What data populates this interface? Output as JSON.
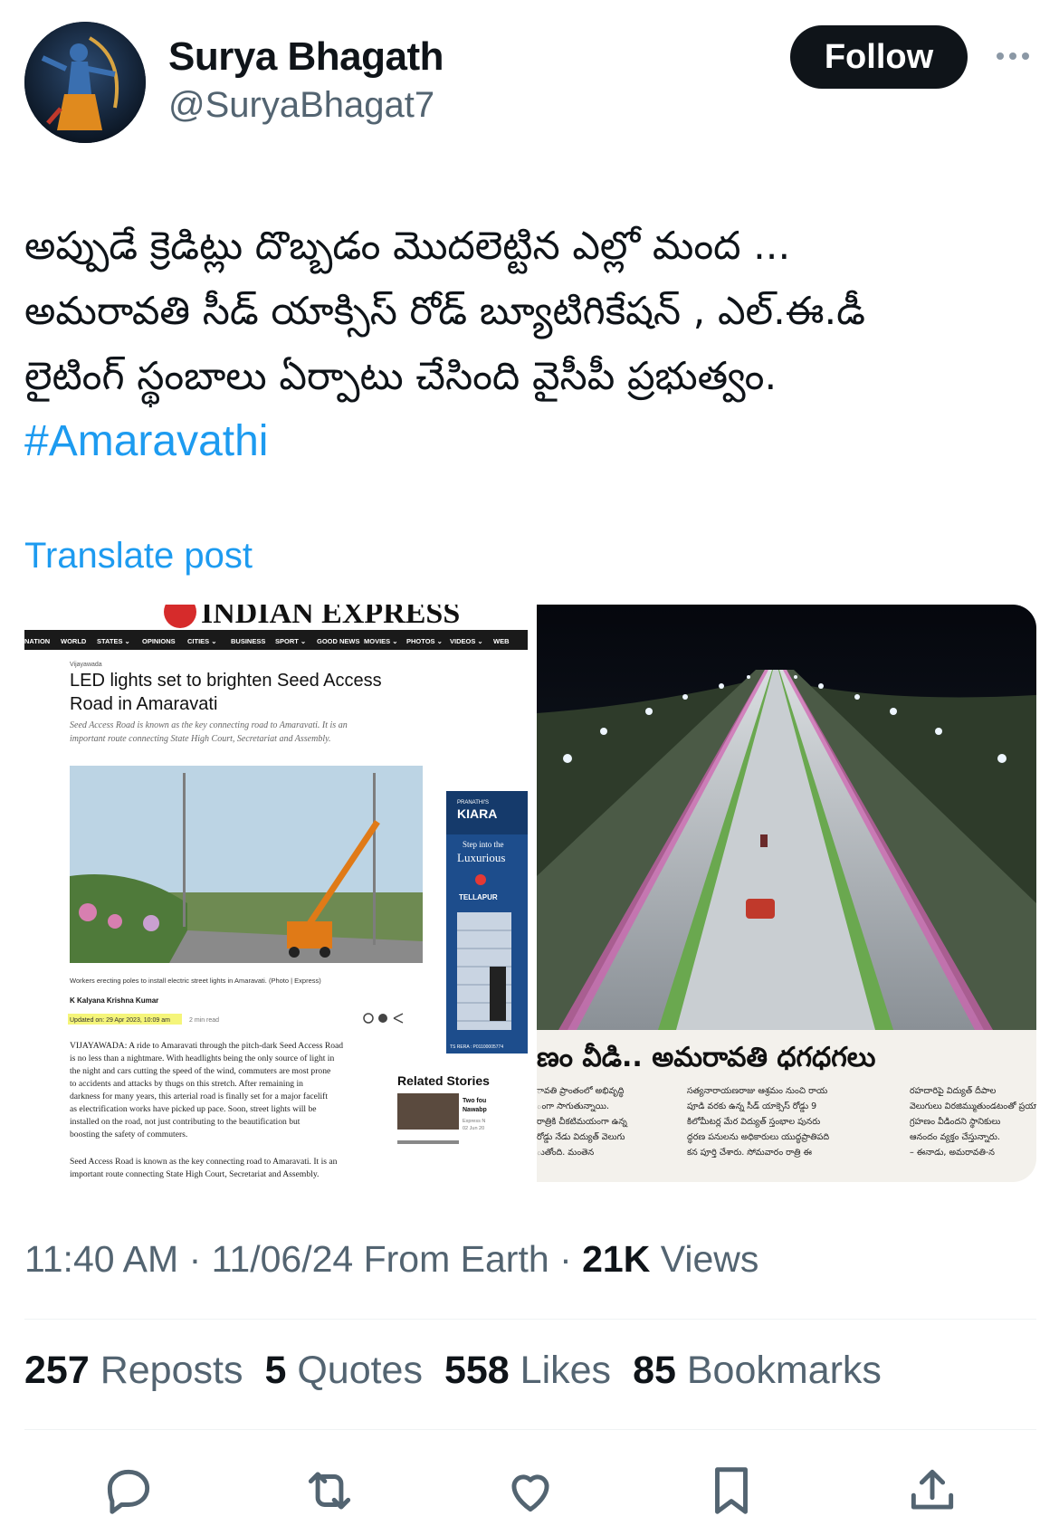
{
  "author": {
    "name": "Surya Bhagath",
    "handle": "@SuryaBhagat7",
    "follow_label": "Follow"
  },
  "tweet": {
    "lines": [
      "అప్పుడే క్రెడిట్లు దొబ్బడం మొదలెట్టిన ఎల్లో మంద ...",
      "అమరావతి సీడ్ యాక్సిస్ రోడ్ బ్యూటిగికేషన్ , ఎల్.ఈ.డీ",
      "లైటింగ్ స్థంబాలు ఏర్పాటు చేసింది వైసీపీ ప్రభుత్వం."
    ],
    "hashtag": "#Amaravathi",
    "translate_label": "Translate post"
  },
  "media": {
    "left": {
      "masthead": "INDIAN EXPRESS",
      "nav": [
        "NATION",
        "WORLD",
        "STATES ⌄",
        "OPINIONS",
        "CITIES ⌄",
        "BUSINESS",
        "SPORT ⌄",
        "GOOD NEWS",
        "MOVIES ⌄",
        "PHOTOS ⌄",
        "VIDEOS ⌄",
        "WEB"
      ],
      "dateline_small": "Vijayawada",
      "headline_1": "LED lights set to brighten Seed Access",
      "headline_2": "Road in Amaravati",
      "sub_1": "Seed Access Road is known as the key connecting road to Amaravati. It is an",
      "sub_2": "important route connecting State High Court, Secretariat and Assembly.",
      "caption": "Workers erecting poles to install electric street lights in Amaravati. (Photo | Express)",
      "byline": "K Kalyana Krishna Kumar",
      "updated": "Updated on: 29 Apr 2023, 10:09 am",
      "read_time": "2 min read",
      "body": [
        "VIJAYAWADA:  A ride to Amaravati through the pitch-dark Seed Access Road",
        "is no less than a nightmare. With headlights being the only source of light in",
        "the night and cars cutting the speed of the wind, commuters are most prone",
        "to  accidents  and  attacks  by  thugs  on  this  stretch.  After  remaining  in",
        "darkness for many years, this arterial road is finally set for a major facelift",
        "as  electrification  works  have  picked  up  pace.  Soon,  street  lights  will  be",
        "installed  on  the  road,  not  just  contributing  to  the  beautification  but",
        "boosting the safety of commuters."
      ],
      "body2_1": "Seed Access Road is known as the key connecting road to Amaravati. It is an",
      "body2_2": "important route connecting State High Court, Secretariat and Assembly.",
      "ad_brand": "KIARA",
      "ad_brand_small": "PRANATHI'S",
      "ad_tag_1": "Step into the",
      "ad_tag_2": "Luxurious",
      "ad_loc": "TELLAPUR",
      "ad_rera": "TS RERA : P01100005774",
      "related": "Related Stories",
      "related_1": "Two fou",
      "related_2": "Nawabp",
      "related_3": "Express N",
      "related_4": "02 Jun 20"
    },
    "right": {
      "banner": "ణం వీడి.. అమరావతి ధగధగలు",
      "col1": [
        "ావతి ప్రాంతంలో అభివృద్ధి",
        "ంగా సాగుతున్నాయి.",
        "రాత్రికి చీకటిమయంగా ఉన్న",
        "రోడ్డు నేడు విద్యుత్ వెలుగు",
        "ుతోంది. మంతెన"
      ],
      "col2": [
        "సత్యనారాయణరాజు ఆశ్రమం నుంచి రాయ",
        "పూడి వరకు ఉన్న సీడ్ యాక్సెస్ రోడ్డు 9",
        "కిలోమీటర్ల మేర విద్యుత్ స్తంభాల పునరు",
        "ద్ధరణ పనులను అధికారులు యుద్ధప్రాతిపది",
        "కన పూర్తి చేశారు. సోమవారం రాత్రి ఈ"
      ],
      "col3": [
        "రహదారిపై విద్యుత్ దీపాల",
        "వెలుగులు విరజిమ్ముతుండటంతో ప్రయాణికులు",
        "గ్రహణం వీడిందని స్థానికులు",
        "ఆనందం వ్యక్తం చేస్తున్నారు.",
        "– ఈనాడు, అమరావతి-న"
      ]
    }
  },
  "meta": {
    "time": "11:40 AM",
    "date": "11/06/24",
    "from": "From Earth",
    "views_count": "21K",
    "views_label": "Views"
  },
  "stats": {
    "reposts_count": "257",
    "reposts_label": "Reposts",
    "quotes_count": "5",
    "quotes_label": "Quotes",
    "likes_count": "558",
    "likes_label": "Likes",
    "bookmarks_count": "85",
    "bookmarks_label": "Bookmarks"
  },
  "colors": {
    "accent": "#1d9bf0",
    "text": "#0f1419",
    "secondary": "#536471",
    "divider": "#eff3f4"
  },
  "icons": [
    "reply-icon",
    "repost-icon",
    "like-icon",
    "bookmark-icon",
    "share-icon",
    "more-icon"
  ]
}
